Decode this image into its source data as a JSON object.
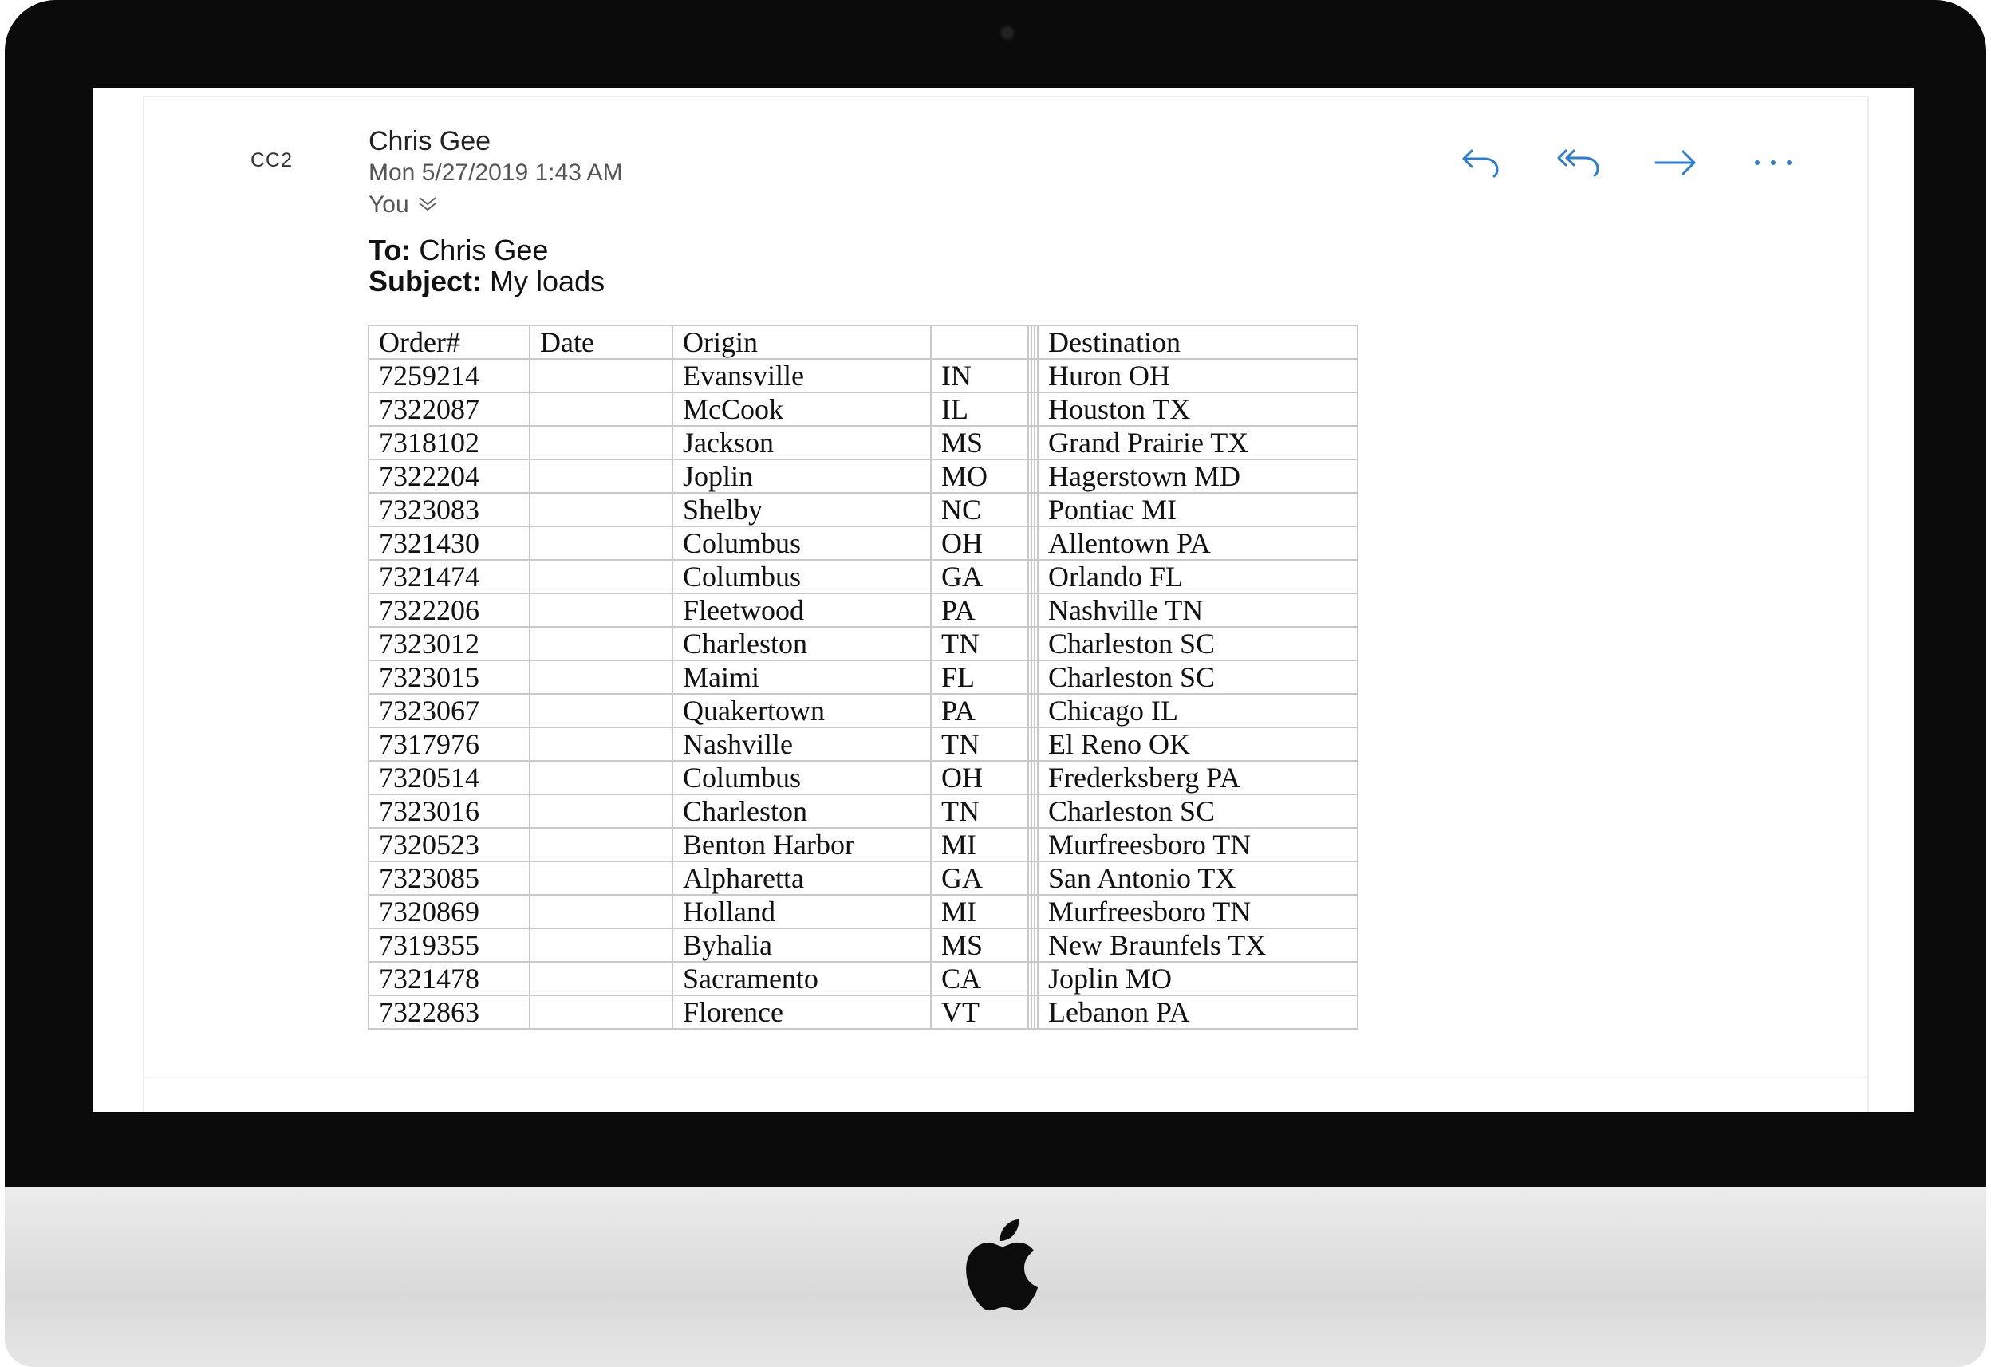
{
  "email": {
    "avatar_initials": "CC2",
    "sender": "Chris Gee",
    "date": "Mon 5/27/2019 1:43 AM",
    "recipient_label": "You",
    "to_label": "To:",
    "to_value": "Chris Gee",
    "subject_label": "Subject:",
    "subject_value": "My loads"
  },
  "actions": [
    {
      "name": "reply",
      "icon": "reply-icon"
    },
    {
      "name": "reply-all",
      "icon": "reply-all-icon"
    },
    {
      "name": "forward",
      "icon": "forward-icon"
    },
    {
      "name": "more",
      "icon": "more-icon"
    }
  ],
  "accent_color": "#2b7cd3",
  "table": {
    "headers": {
      "order": "Order#",
      "date": "Date",
      "origin": "Origin",
      "state": "",
      "destination": "Destination"
    },
    "rows": [
      {
        "order": "7259214",
        "date": "",
        "origin": "Evansville",
        "state": "IN",
        "destination": "Huron OH"
      },
      {
        "order": "7322087",
        "date": "",
        "origin": "McCook",
        "state": "IL",
        "destination": "Houston TX"
      },
      {
        "order": "7318102",
        "date": "",
        "origin": "Jackson",
        "state": "MS",
        "destination": "Grand Prairie TX"
      },
      {
        "order": "7322204",
        "date": "",
        "origin": "Joplin",
        "state": "MO",
        "destination": "Hagerstown MD"
      },
      {
        "order": "7323083",
        "date": "",
        "origin": "Shelby",
        "state": "NC",
        "destination": "Pontiac MI"
      },
      {
        "order": "7321430",
        "date": "",
        "origin": "Columbus",
        "state": "OH",
        "destination": "Allentown PA"
      },
      {
        "order": "7321474",
        "date": "",
        "origin": "Columbus",
        "state": "GA",
        "destination": "Orlando FL"
      },
      {
        "order": "7322206",
        "date": "",
        "origin": "Fleetwood",
        "state": "PA",
        "destination": "Nashville TN"
      },
      {
        "order": "7323012",
        "date": "",
        "origin": "Charleston",
        "state": "TN",
        "destination": "Charleston SC"
      },
      {
        "order": "7323015",
        "date": "",
        "origin": "Maimi",
        "state": "FL",
        "destination": "Charleston SC"
      },
      {
        "order": "7323067",
        "date": "",
        "origin": "Quakertown",
        "state": "PA",
        "destination": "Chicago IL"
      },
      {
        "order": "7317976",
        "date": "",
        "origin": "Nashville",
        "state": "TN",
        "destination": "El Reno OK"
      },
      {
        "order": "7320514",
        "date": "",
        "origin": "Columbus",
        "state": "OH",
        "destination": "Frederksberg PA"
      },
      {
        "order": "7323016",
        "date": "",
        "origin": "Charleston",
        "state": "TN",
        "destination": "Charleston SC"
      },
      {
        "order": "7320523",
        "date": "",
        "origin": "Benton Harbor",
        "state": "MI",
        "destination": "Murfreesboro TN"
      },
      {
        "order": "7323085",
        "date": "",
        "origin": "Alpharetta",
        "state": "GA",
        "destination": "San Antonio TX"
      },
      {
        "order": "7320869",
        "date": "",
        "origin": "Holland",
        "state": "MI",
        "destination": "Murfreesboro TN"
      },
      {
        "order": "7319355",
        "date": "",
        "origin": "Byhalia",
        "state": "MS",
        "destination": "New Braunfels TX"
      },
      {
        "order": "7321478",
        "date": "",
        "origin": "Sacramento",
        "state": "CA",
        "destination": "Joplin MO"
      },
      {
        "order": "7322863",
        "date": "",
        "origin": "Florence",
        "state": "VT",
        "destination": "Lebanon PA"
      }
    ]
  }
}
